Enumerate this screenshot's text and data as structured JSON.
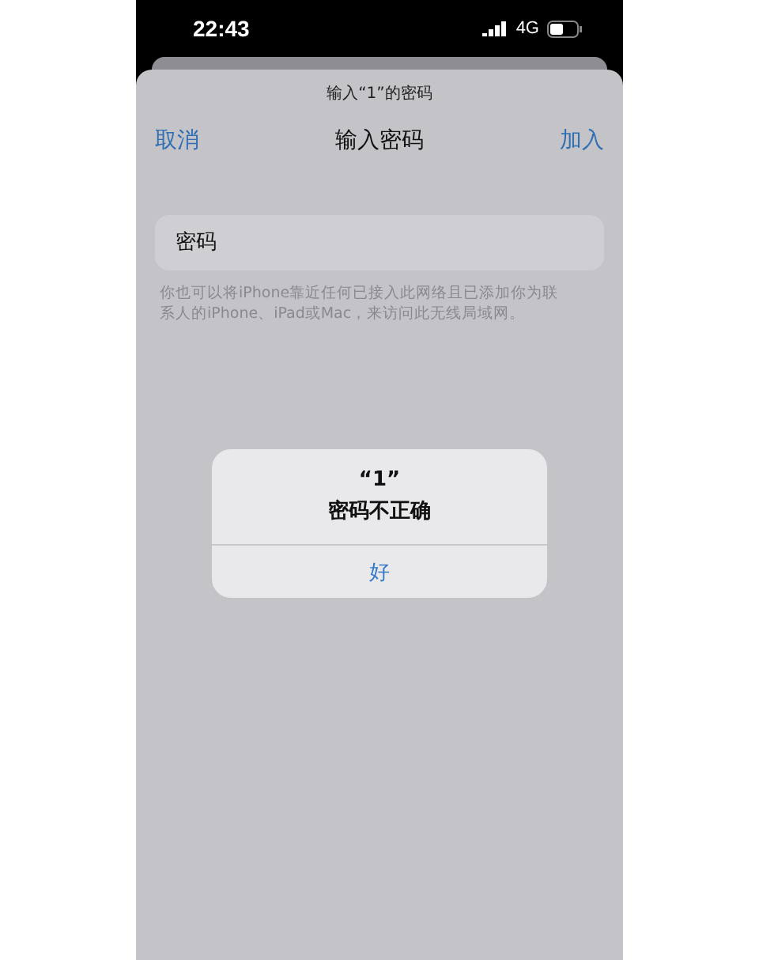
{
  "status_bar": {
    "time": "22:43",
    "network": "4G"
  },
  "sheet": {
    "subtitle": "输入“1”的密码",
    "cancel": "取消",
    "title": "输入密码",
    "join": "加入",
    "password_field": {
      "placeholder": "密码"
    },
    "hint": "你也可以将iPhone靠近任何已接入此网络且已添加你为联系人的iPhone、iPad或Mac，来访问此无线局域网。"
  },
  "alert": {
    "title": "“1”",
    "message": "密码不正确",
    "button": "好"
  }
}
